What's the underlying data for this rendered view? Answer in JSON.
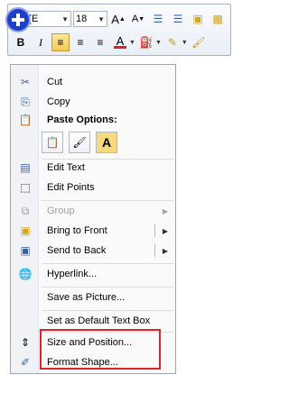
{
  "toolbar": {
    "font_name": "bri (E",
    "font_size": "18",
    "grow_font": "A",
    "shrink_font": "A",
    "bold": "B",
    "italic": "I",
    "font_color": "A"
  },
  "menu": {
    "cut": "Cut",
    "copy": "Copy",
    "paste_options": "Paste Options:",
    "paste_option_text": "A",
    "edit_text": "Edit Text",
    "edit_points": "Edit Points",
    "group": "Group",
    "bring_to_front": "Bring to Front",
    "send_to_back": "Send to Back",
    "hyperlink": "Hyperlink...",
    "save_as_picture": "Save as Picture...",
    "set_default": "Set as Default Text Box",
    "size_position": "Size and Position...",
    "format_shape": "Format Shape..."
  },
  "colors": {
    "highlight_box": "#d8262b",
    "font_color_bar": "#e02020"
  }
}
